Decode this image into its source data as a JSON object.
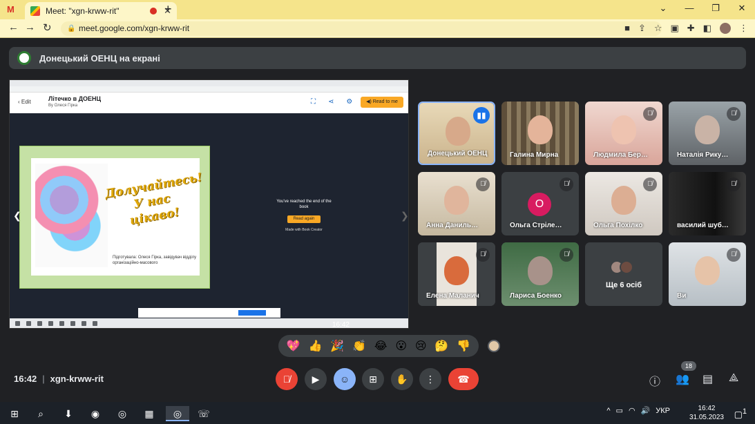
{
  "browser": {
    "tab_title": "Meet: \"xgn-krww-rit\"",
    "url": "meet.google.com/xgn-krww-rit"
  },
  "presentation": {
    "banner": "Донецький ОЕНЦ на екрані",
    "book_edit": "Edit",
    "book_title": "Літечко в ДОЕНЦ",
    "book_by": "By Олеся Гірка",
    "read_to_me": "Read to me",
    "slogan": "Долучайтесь! У нас цікаво!",
    "credit": "Підготувала: Олеся Гірка, завідувач відділу організаційно-масового",
    "end_text": "You've reached the end of the book",
    "read_again": "Read again",
    "made_with": "Made with Book Creator",
    "mini_clock": "16:42"
  },
  "participants": [
    {
      "name": "Донецький ОЕНЦ",
      "status": "speaking"
    },
    {
      "name": "Галина Мирна",
      "status": "on"
    },
    {
      "name": "Людмила Бер…",
      "status": "muted"
    },
    {
      "name": "Наталія Рику…",
      "status": "muted"
    },
    {
      "name": "Анна Даниль…",
      "status": "muted"
    },
    {
      "name": "Ольга Стріле…",
      "status": "muted",
      "initial": "О"
    },
    {
      "name": "Ольга Похілко",
      "status": "muted"
    },
    {
      "name": "василий шуб…",
      "status": "muted"
    },
    {
      "name": "Елена Маланич",
      "status": "muted"
    },
    {
      "name": "Лариса Боенко",
      "status": "muted"
    },
    {
      "name": "Ще 6 осіб",
      "status": "more"
    },
    {
      "name": "Ви",
      "status": "muted"
    }
  ],
  "reactions": [
    "💖",
    "👍",
    "🎉",
    "👏",
    "😂",
    "😮",
    "😢",
    "🤔",
    "👎"
  ],
  "meeting": {
    "time": "16:42",
    "code": "xgn-krww-rit",
    "participant_count": "18"
  },
  "taskbar": {
    "lang": "УКР",
    "time": "16:42",
    "date": "31.05.2023",
    "notifications": "1"
  }
}
